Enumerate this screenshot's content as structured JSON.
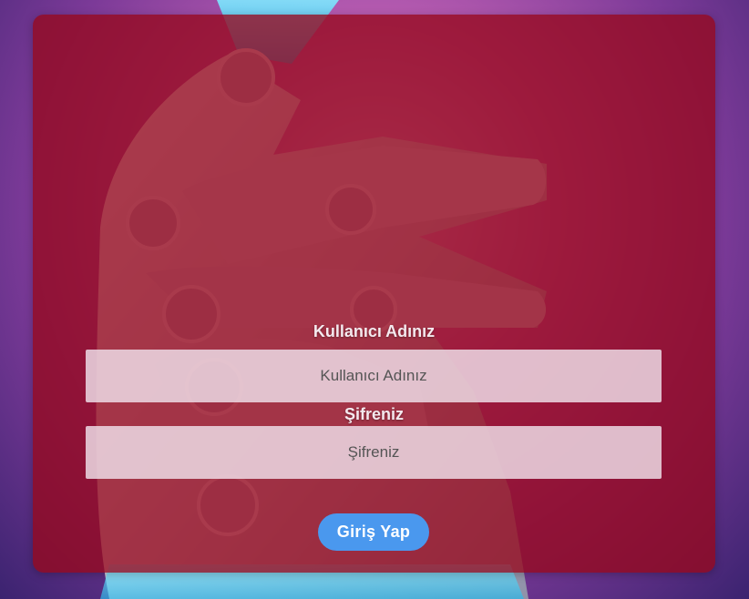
{
  "form": {
    "username_label": "Kullanıcı Adınız",
    "username_placeholder": "Kullanıcı Adınız",
    "username_value": "",
    "password_label": "Şifreniz",
    "password_placeholder": "Şifreniz",
    "password_value": "",
    "submit_label": "Giriş Yap"
  },
  "colors": {
    "card_overlay": "#96081c",
    "button": "#4a98ee",
    "input_bg": "#f0e2ec"
  },
  "background": {
    "icon": "robot-hand-image"
  }
}
